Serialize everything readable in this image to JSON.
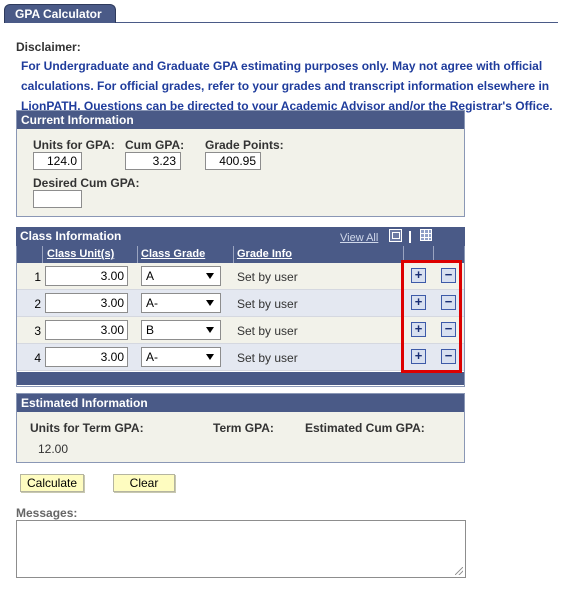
{
  "tab": {
    "title": "GPA Calculator"
  },
  "disclaimer": {
    "label": "Disclaimer:",
    "lines": [
      "For Undergraduate and Graduate GPA estimating purposes only. May not agree with official",
      "calculations. For official grades, refer to your grades and transcript information elsewhere in",
      "LionPATH. Questions can be directed to your Academic Advisor and/or the Registrar's Office."
    ]
  },
  "current": {
    "title": "Current Information",
    "units_label": "Units for GPA:",
    "units_value": "124.0",
    "cum_label": "Cum GPA:",
    "cum_value": "3.23",
    "points_label": "Grade Points:",
    "points_value": "400.95",
    "desired_label": "Desired Cum GPA:",
    "desired_value": ""
  },
  "class_info": {
    "title": "Class Information",
    "view_all": "View All",
    "col_units": "Class Unit(s)",
    "col_grade": "Class Grade",
    "col_info": "Grade Info",
    "add_symbol": "+",
    "del_symbol": "−",
    "rows": [
      {
        "num": "1",
        "units": "3.00",
        "grade": "A",
        "info": "Set by user"
      },
      {
        "num": "2",
        "units": "3.00",
        "grade": "A-",
        "info": "Set by user"
      },
      {
        "num": "3",
        "units": "3.00",
        "grade": "B",
        "info": "Set by user"
      },
      {
        "num": "4",
        "units": "3.00",
        "grade": "A-",
        "info": "Set by user"
      }
    ]
  },
  "estimated": {
    "title": "Estimated Information",
    "units_label": "Units for Term GPA:",
    "units_value": "12.00",
    "term_label": "Term GPA:",
    "term_value": "",
    "cum_label": "Estimated Cum GPA:",
    "cum_value": ""
  },
  "buttons": {
    "calculate": "Calculate",
    "clear": "Clear"
  },
  "messages": {
    "label": "Messages:",
    "value": ""
  },
  "colors": {
    "header": "#4a5a87",
    "link_text": "#1f3c9c",
    "highlight": "#dd0000",
    "button_bg": "#fefcc0"
  }
}
